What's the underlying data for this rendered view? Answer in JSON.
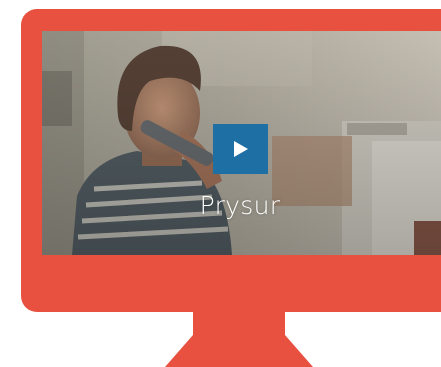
{
  "video": {
    "title": "Prysur",
    "play_icon": "play-icon",
    "play_button_color": "#1e6fa3"
  },
  "monitor": {
    "frame_color": "#e85140"
  }
}
